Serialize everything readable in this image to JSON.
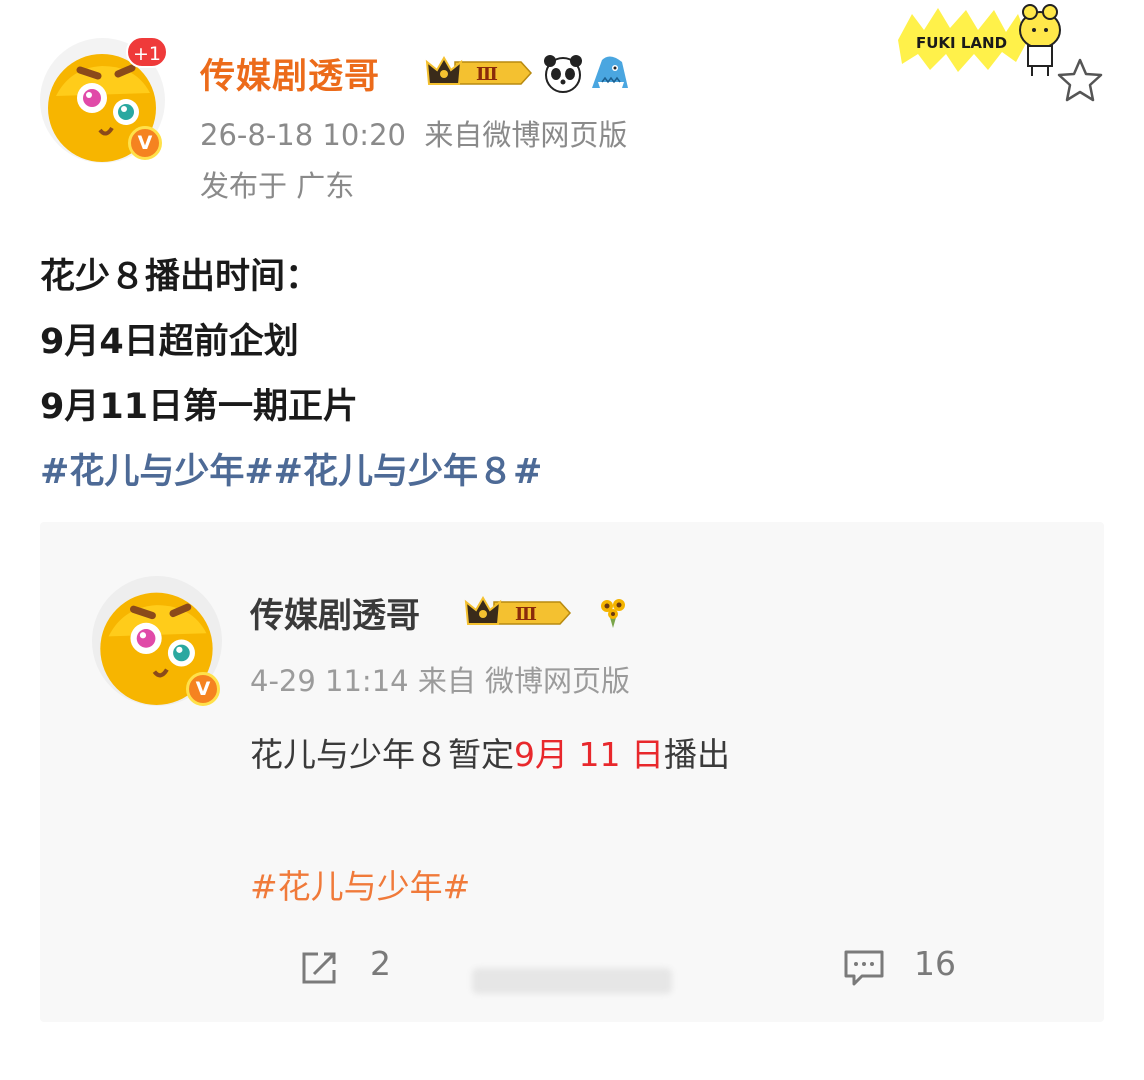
{
  "header": {
    "notif_badge": "+1",
    "username": "传媒剧透哥",
    "vip_level": "Ⅲ",
    "badges": [
      "panda-icon",
      "shark-icon"
    ],
    "timestamp": "26-8-18 10:20",
    "source": "来自微博网页版",
    "location": "发布于 广东",
    "verified_mark": "V"
  },
  "sticker": {
    "text": "FUKI LAND"
  },
  "post": {
    "lines": [
      "花少８播出时间：",
      "9月4日超前企划",
      "9月11日第一期正片"
    ],
    "topics": "#花儿与少年##花儿与少年８#"
  },
  "repost": {
    "username": "传媒剧透哥",
    "vip_level": "Ⅲ",
    "timestamp": "4-29 11:14",
    "source": "来自 微博网页版",
    "text_before": "花儿与少年８暂定",
    "text_highlight": "9月 11 日",
    "text_after": "播出",
    "topic": "#花儿与少年#",
    "share_count": "2",
    "comment_count": "16",
    "verified_mark": "V"
  },
  "colors": {
    "username": "#ec6b1a",
    "topic_blue": "#4d6a96",
    "topic_orange": "#f07a3a",
    "highlight_red": "#e8282c"
  }
}
